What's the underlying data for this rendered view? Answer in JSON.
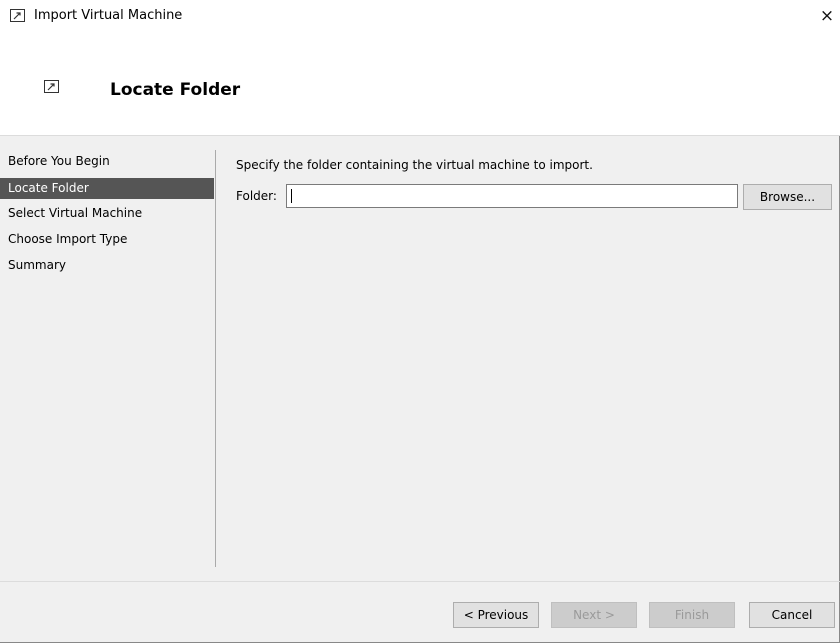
{
  "window": {
    "title": "Import Virtual Machine",
    "close_glyph": "×",
    "app_icon": "import-vm-icon"
  },
  "header": {
    "title": "Locate Folder",
    "icon": "import-vm-icon"
  },
  "sidebar": {
    "items": [
      {
        "label": "Before You Begin",
        "active": false
      },
      {
        "label": "Locate Folder",
        "active": true
      },
      {
        "label": "Select Virtual Machine",
        "active": false
      },
      {
        "label": "Choose Import Type",
        "active": false
      },
      {
        "label": "Summary",
        "active": false
      }
    ]
  },
  "main": {
    "instruction": "Specify the folder containing the virtual machine to import.",
    "folder_label": "Folder:",
    "folder_value": "",
    "browse_label": "Browse..."
  },
  "footer": {
    "previous_label": "< Previous",
    "next_label": "Next >",
    "finish_label": "Finish",
    "cancel_label": "Cancel",
    "next_enabled": false,
    "finish_enabled": false
  },
  "colors": {
    "nav_active_bg": "#555555",
    "window_bg": "#f0f0f0",
    "header_bg": "#ffffff"
  }
}
